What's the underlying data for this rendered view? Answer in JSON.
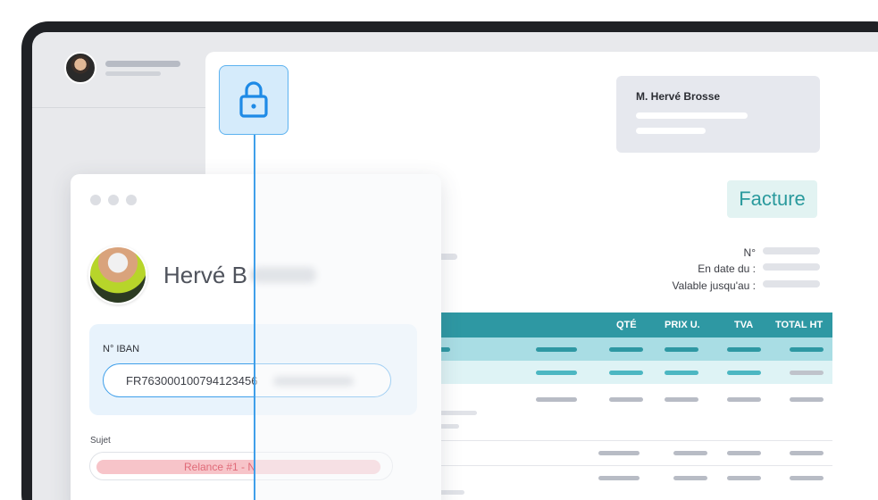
{
  "invoice": {
    "client_name": "M. Hervé Brosse",
    "doc_type": "Facture",
    "meta_labels": [
      "N°",
      "En date du :",
      "Valable jusqu'au :"
    ],
    "columns": [
      "QTÉ",
      "PRIX U.",
      "TVA",
      "TOTAL HT"
    ]
  },
  "email_card": {
    "recipient_name": "Hervé B",
    "iban_label": "N° IBAN",
    "iban_value": "FR763000100794123456",
    "subject_label": "Sujet",
    "subject_value": "Relance #1 - N"
  },
  "icons": {
    "lock": "lock-icon",
    "window_dots": "window-dots-icon"
  },
  "colors": {
    "accent_teal": "#2e98a3",
    "accent_blue": "#3f9fea",
    "subject_red": "#e06a78"
  }
}
